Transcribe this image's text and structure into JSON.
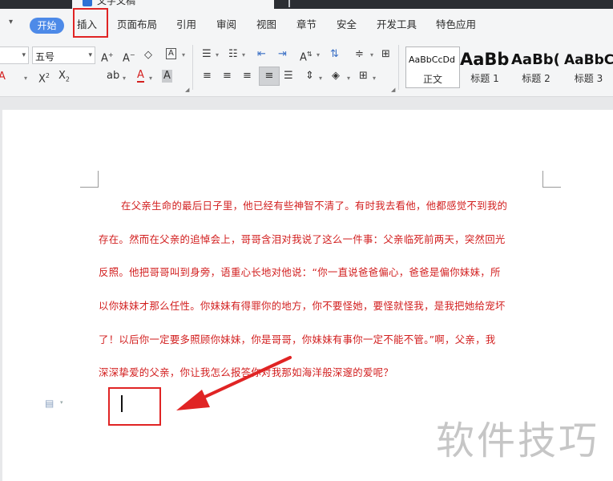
{
  "title_bar": {
    "tab_title": "文字文稿"
  },
  "menu": {
    "items": [
      "开始",
      "插入",
      "页面布局",
      "引用",
      "审阅",
      "视图",
      "章节",
      "安全",
      "开发工具",
      "特色应用"
    ],
    "highlighted": "插入"
  },
  "ribbon": {
    "font_name": "",
    "font_size": "五号",
    "styles": [
      {
        "preview": "AaBbCcDd",
        "label": "正文"
      },
      {
        "preview": "AaBb",
        "label": "标题 1"
      },
      {
        "preview": "AaBb(",
        "label": "标题 2"
      },
      {
        "preview": "AaBbC",
        "label": "标题 3"
      }
    ]
  },
  "document": {
    "lines": [
      "在父亲生命的最后日子里，他已经有些神智不清了。有时我去看他，他都感觉不到我的",
      "存在。然而在父亲的追悼会上，哥哥含泪对我说了这么一件事：父亲临死前两天，突然回光",
      "反照。他把哥哥叫到身旁，语重心长地对他说：“你一直说爸爸偏心，爸爸是偏你妹妹，所",
      "以你妹妹才那么任性。你妹妹有得罪你的地方，你不要怪她，要怪就怪我，是我把她给宠坏",
      "了！以后你一定要多照顾你妹妹，你是哥哥，你妹妹有事你一定不能不管。”啊，父亲，我",
      "深深挚爱的父亲，你让我怎么报答你对我那如海洋般深邃的爱呢？"
    ]
  },
  "watermark": "软件技巧",
  "colors": {
    "text_red": "#d21f1f",
    "accent_blue": "#4d8ae8",
    "annotation_red": "#e02424"
  }
}
